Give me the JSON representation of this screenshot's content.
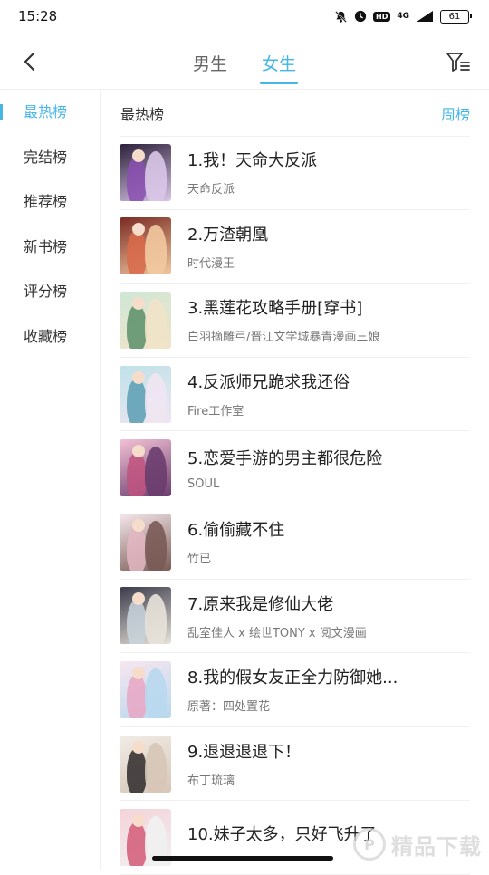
{
  "status_bar": {
    "time": "15:28",
    "network": "4G",
    "battery": "61",
    "hd": "HD",
    "icons": [
      "mute-bell-icon",
      "clock-icon",
      "hd-icon",
      "signal-icon",
      "battery-icon"
    ]
  },
  "header": {
    "tabs": [
      {
        "label": "男生",
        "active": false
      },
      {
        "label": "女生",
        "active": true
      }
    ],
    "icons": [
      "back-arrow-icon",
      "filter-icon"
    ]
  },
  "sidebar": {
    "items": [
      {
        "label": "最热榜",
        "active": true
      },
      {
        "label": "完结榜",
        "active": false
      },
      {
        "label": "推荐榜",
        "active": false
      },
      {
        "label": "新书榜",
        "active": false
      },
      {
        "label": "评分榜",
        "active": false
      },
      {
        "label": "收藏榜",
        "active": false
      }
    ]
  },
  "ranking": {
    "title": "最热榜",
    "period": "周榜",
    "items": [
      {
        "title": "1.我！天命大反派",
        "author": "天命反派",
        "cover_colors": [
          "#2b1f3a",
          "#8a4fb0",
          "#d9c6e8"
        ]
      },
      {
        "title": "2.万渣朝凰",
        "author": "时代漫王",
        "cover_colors": [
          "#7a2a22",
          "#d96a4a",
          "#f2c9a0"
        ]
      },
      {
        "title": "3.黑莲花攻略手册[穿书]",
        "author": "白羽摘雕弓/晋江文学城暴青漫画三娘",
        "cover_colors": [
          "#cfe7d6",
          "#5b8f6a",
          "#f1e3c8"
        ]
      },
      {
        "title": "4.反派师兄跪求我还俗",
        "author": "Fire工作室",
        "cover_colors": [
          "#bfe1e8",
          "#5a9db3",
          "#efe6f2"
        ]
      },
      {
        "title": "5.恋爱手游的男主都很危险",
        "author": "SOUL",
        "cover_colors": [
          "#f3c2d6",
          "#c0527e",
          "#6a3d6e"
        ]
      },
      {
        "title": "6.偷偷藏不住",
        "author": "竹已",
        "cover_colors": [
          "#f6e8ec",
          "#e3b7c2",
          "#7a5a55"
        ]
      },
      {
        "title": "7.原来我是修仙大佬",
        "author": "乱室佳人 x 绘世TONY x 阅文漫画",
        "cover_colors": [
          "#3a3a4a",
          "#c9d3dd",
          "#e8e2d9"
        ]
      },
      {
        "title": "8.我的假女友正全力防御她...",
        "author": "原著：四处置花",
        "cover_colors": [
          "#f7e6ef",
          "#e9a6c4",
          "#b8d8ee"
        ]
      },
      {
        "title": "9.退退退退下！",
        "author": "布丁琉璃",
        "cover_colors": [
          "#f1ece6",
          "#2e2a2a",
          "#d7c6b7"
        ]
      },
      {
        "title": "10.妹子太多，只好飞升了",
        "author": "",
        "cover_colors": [
          "#f4d3da",
          "#d35a78",
          "#f1f1f1"
        ]
      }
    ]
  },
  "watermark": {
    "logo": "P",
    "text": "精品下载"
  },
  "colors": {
    "accent": "#46b6e6",
    "text": "#222222",
    "secondary": "#777777",
    "divider": "#f0f0f0"
  }
}
